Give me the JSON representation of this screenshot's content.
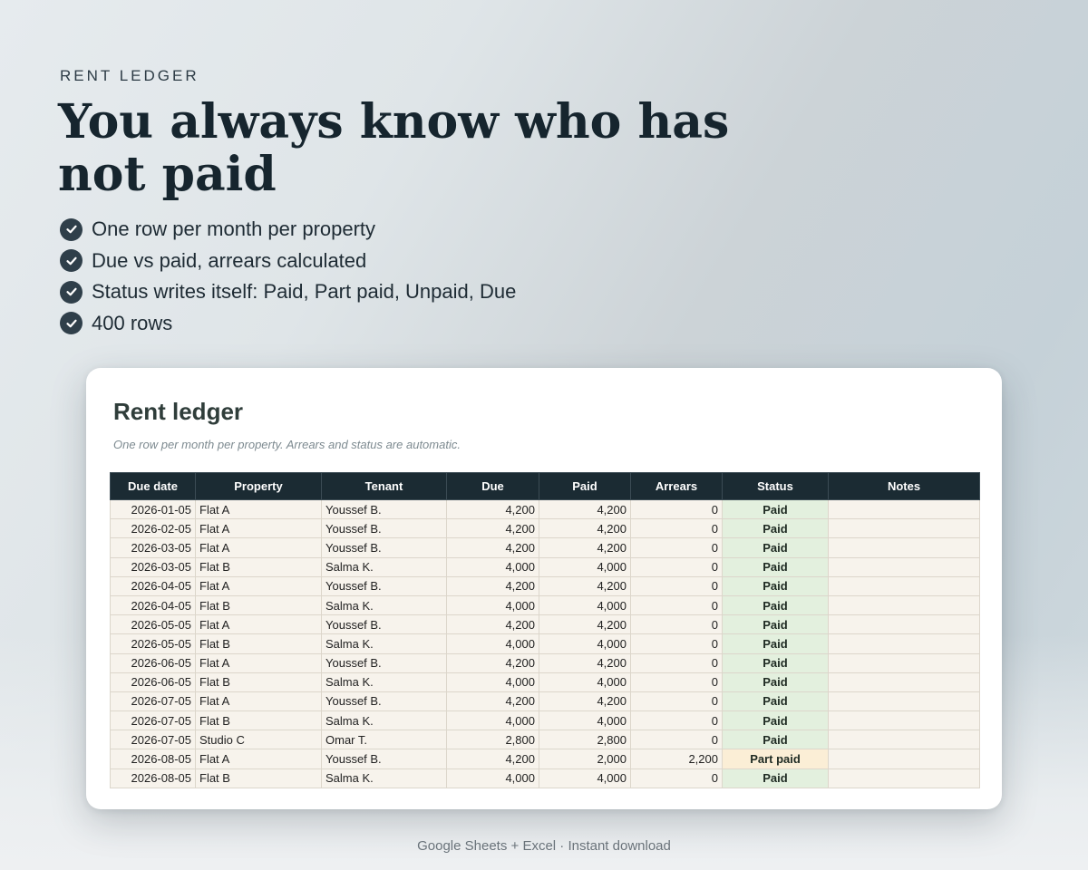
{
  "eyebrow": "RENT LEDGER",
  "headline": "You always know who has not paid",
  "features": [
    "One row per month per property",
    "Due vs paid, arrears calculated",
    "Status writes itself: Paid, Part paid, Unpaid, Due",
    "400 rows"
  ],
  "sheet": {
    "title": "Rent ledger",
    "subtitle": "One row per month per property. Arrears and status are automatic.",
    "columns": [
      "Due date",
      "Property",
      "Tenant",
      "Due",
      "Paid",
      "Arrears",
      "Status",
      "Notes"
    ],
    "rows": [
      [
        "2026-01-05",
        "Flat A",
        "Youssef B.",
        "4,200",
        "4,200",
        "0",
        "Paid",
        ""
      ],
      [
        "2026-02-05",
        "Flat A",
        "Youssef B.",
        "4,200",
        "4,200",
        "0",
        "Paid",
        ""
      ],
      [
        "2026-03-05",
        "Flat A",
        "Youssef B.",
        "4,200",
        "4,200",
        "0",
        "Paid",
        ""
      ],
      [
        "2026-03-05",
        "Flat B",
        "Salma K.",
        "4,000",
        "4,000",
        "0",
        "Paid",
        ""
      ],
      [
        "2026-04-05",
        "Flat A",
        "Youssef B.",
        "4,200",
        "4,200",
        "0",
        "Paid",
        ""
      ],
      [
        "2026-04-05",
        "Flat B",
        "Salma K.",
        "4,000",
        "4,000",
        "0",
        "Paid",
        ""
      ],
      [
        "2026-05-05",
        "Flat A",
        "Youssef B.",
        "4,200",
        "4,200",
        "0",
        "Paid",
        ""
      ],
      [
        "2026-05-05",
        "Flat B",
        "Salma K.",
        "4,000",
        "4,000",
        "0",
        "Paid",
        ""
      ],
      [
        "2026-06-05",
        "Flat A",
        "Youssef B.",
        "4,200",
        "4,200",
        "0",
        "Paid",
        ""
      ],
      [
        "2026-06-05",
        "Flat B",
        "Salma K.",
        "4,000",
        "4,000",
        "0",
        "Paid",
        ""
      ],
      [
        "2026-07-05",
        "Flat A",
        "Youssef B.",
        "4,200",
        "4,200",
        "0",
        "Paid",
        ""
      ],
      [
        "2026-07-05",
        "Flat B",
        "Salma K.",
        "4,000",
        "4,000",
        "0",
        "Paid",
        ""
      ],
      [
        "2026-07-05",
        "Studio C",
        "Omar T.",
        "2,800",
        "2,800",
        "0",
        "Paid",
        ""
      ],
      [
        "2026-08-05",
        "Flat A",
        "Youssef B.",
        "4,200",
        "2,000",
        "2,200",
        "Part paid",
        ""
      ],
      [
        "2026-08-05",
        "Flat B",
        "Salma K.",
        "4,000",
        "4,000",
        "0",
        "Paid",
        ""
      ]
    ]
  },
  "footer": "Google Sheets + Excel  ·  Instant download",
  "colors": {
    "header_bg": "#1b2b33",
    "paid_bg": "#e3f0de",
    "part_paid_bg": "#fbeed6",
    "row_bg": "#f7f3ec",
    "check_bg": "#2f3f4a"
  }
}
